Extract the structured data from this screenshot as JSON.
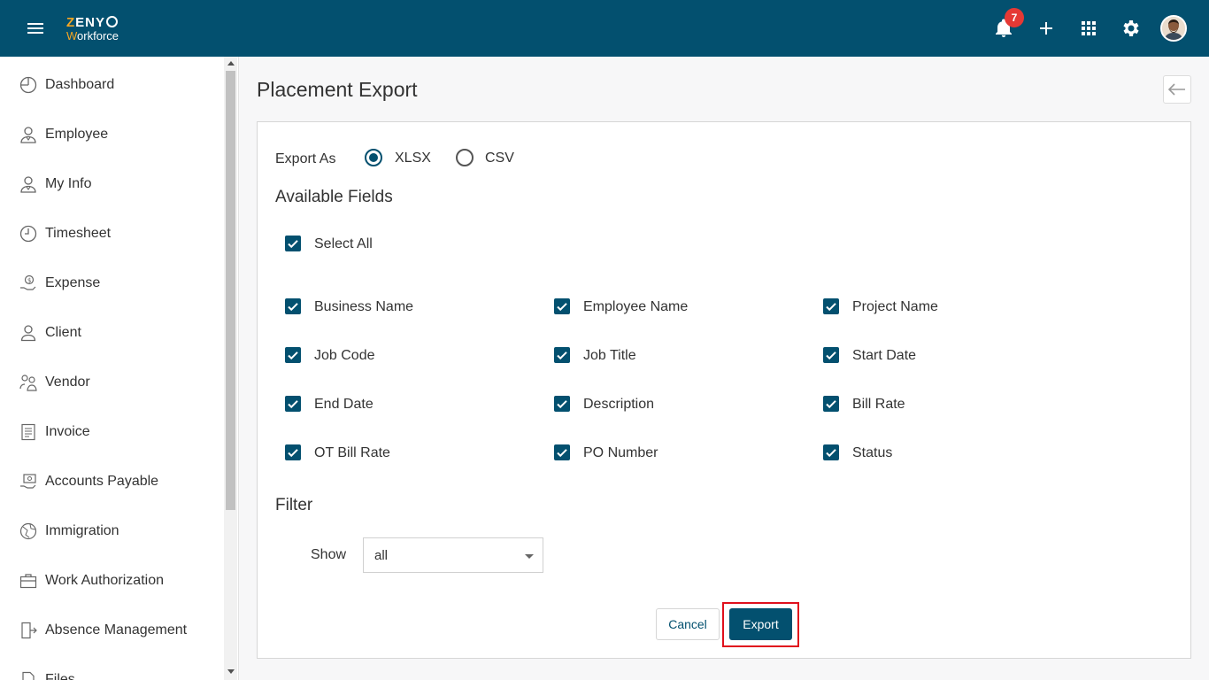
{
  "app": {
    "logo_line1": "ZENYO",
    "logo_line2": "Workforce",
    "notification_count": "7"
  },
  "sidebar": {
    "items": [
      {
        "label": "Dashboard",
        "icon": "dashboard-icon"
      },
      {
        "label": "Employee",
        "icon": "employee-icon"
      },
      {
        "label": "My Info",
        "icon": "my-info-icon"
      },
      {
        "label": "Timesheet",
        "icon": "clock-icon"
      },
      {
        "label": "Expense",
        "icon": "money-hand-icon"
      },
      {
        "label": "Client",
        "icon": "user-icon"
      },
      {
        "label": "Vendor",
        "icon": "vendor-icon"
      },
      {
        "label": "Invoice",
        "icon": "invoice-icon"
      },
      {
        "label": "Accounts Payable",
        "icon": "payable-icon"
      },
      {
        "label": "Immigration",
        "icon": "globe-icon"
      },
      {
        "label": "Work Authorization",
        "icon": "briefcase-icon"
      },
      {
        "label": "Absence Management",
        "icon": "door-exit-icon"
      },
      {
        "label": "Files",
        "icon": "file-icon"
      }
    ]
  },
  "page": {
    "title": "Placement Export"
  },
  "export_as": {
    "label": "Export As",
    "options": [
      {
        "label": "XLSX",
        "selected": true
      },
      {
        "label": "CSV",
        "selected": false
      }
    ]
  },
  "fields": {
    "heading": "Available Fields",
    "select_all": {
      "label": "Select All",
      "checked": true
    },
    "items": [
      {
        "label": "Business Name",
        "checked": true
      },
      {
        "label": "Employee Name",
        "checked": true
      },
      {
        "label": "Project Name",
        "checked": true
      },
      {
        "label": "Job Code",
        "checked": true
      },
      {
        "label": "Job Title",
        "checked": true
      },
      {
        "label": "Start Date",
        "checked": true
      },
      {
        "label": "End Date",
        "checked": true
      },
      {
        "label": "Description",
        "checked": true
      },
      {
        "label": "Bill Rate",
        "checked": true
      },
      {
        "label": "OT Bill Rate",
        "checked": true
      },
      {
        "label": "PO Number",
        "checked": true
      },
      {
        "label": "Status",
        "checked": true
      }
    ]
  },
  "filter": {
    "heading": "Filter",
    "show_label": "Show",
    "show_value": "all"
  },
  "actions": {
    "cancel_label": "Cancel",
    "export_label": "Export"
  },
  "colors": {
    "primary": "#03506f",
    "badge": "#e53935",
    "highlight": "#e0101c",
    "logo_accent": "#f5a623"
  }
}
